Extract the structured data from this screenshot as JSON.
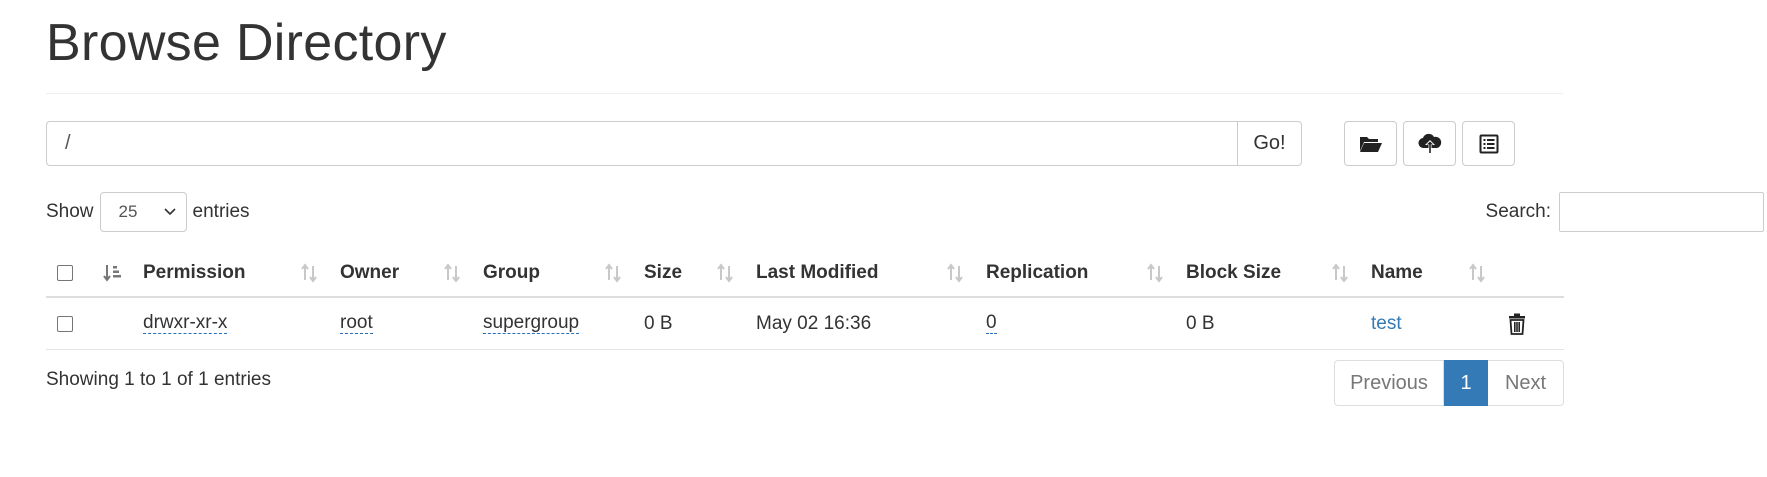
{
  "header": {
    "title": "Browse Directory"
  },
  "path_bar": {
    "value": "/",
    "go_label": "Go!"
  },
  "toolbar": {
    "icons": [
      "folder-open-icon",
      "cloud-upload-icon",
      "list-alt-icon"
    ]
  },
  "length_menu": {
    "show_label": "Show",
    "selected": "25",
    "entries_label": "entries"
  },
  "search": {
    "label": "Search:",
    "value": ""
  },
  "table": {
    "columns": [
      "Permission",
      "Owner",
      "Group",
      "Size",
      "Last Modified",
      "Replication",
      "Block Size",
      "Name"
    ],
    "rows": [
      {
        "permission": "drwxr-xr-x",
        "owner": "root",
        "group": "supergroup",
        "size": "0 B",
        "last_modified": "May 02 16:36",
        "replication": "0",
        "block_size": "0 B",
        "name": "test"
      }
    ]
  },
  "footer": {
    "info": "Showing 1 to 1 of 1 entries",
    "pagination": {
      "previous": "Previous",
      "current": "1",
      "next": "Next"
    }
  },
  "colors": {
    "accent": "#337ab7",
    "border": "#cccccc",
    "text": "#333333"
  }
}
